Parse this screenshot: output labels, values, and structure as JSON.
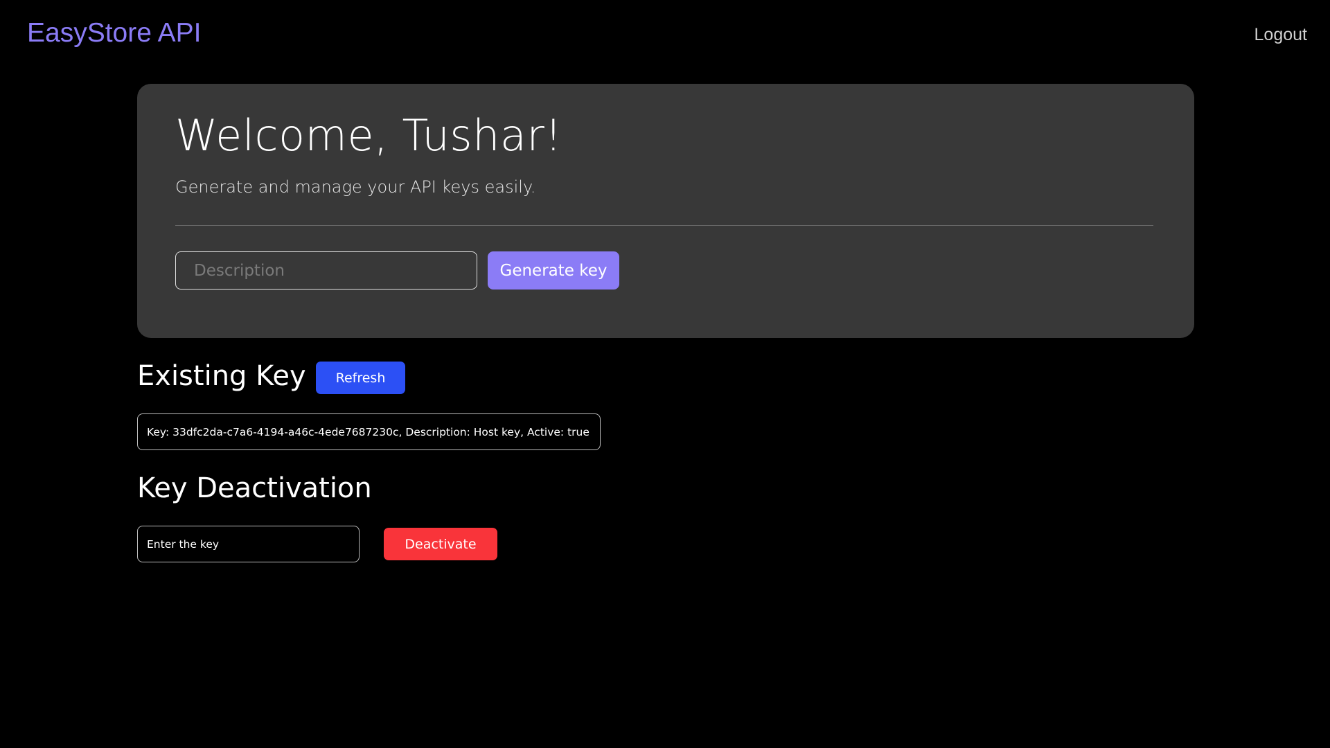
{
  "header": {
    "brand": "EasyStore API",
    "logout_label": "Logout"
  },
  "hero": {
    "title": "Welcome, Tushar!",
    "subtitle": "Generate and manage your API keys easily.",
    "description_placeholder": "Description",
    "description_value": "",
    "generate_label": "Generate key"
  },
  "existing": {
    "title": "Existing Key",
    "refresh_label": "Refresh",
    "key_text": "Key: 33dfc2da-c7a6-4194-a46c-4ede7687230c, Description: Host key, Active: true"
  },
  "deactivation": {
    "title": "Key Deactivation",
    "key_placeholder": "Enter the key",
    "deactivate_label": "Deactivate"
  },
  "colors": {
    "background": "#000000",
    "accent": "#8b7cf6",
    "card": "#383838",
    "refresh": "#2c50f5",
    "danger": "#f9343a"
  }
}
